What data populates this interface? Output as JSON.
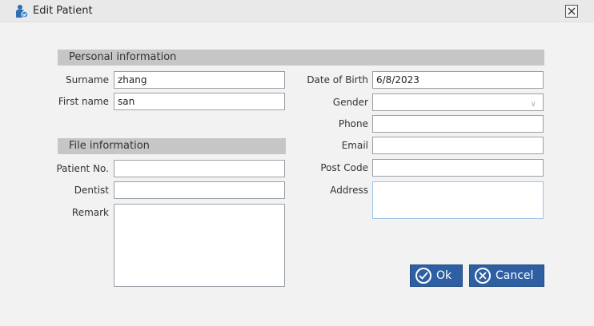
{
  "window": {
    "title": "Edit Patient"
  },
  "personal": {
    "header": "Personal information",
    "surname_label": "Surname",
    "surname_value": "zhang",
    "firstname_label": "First name",
    "firstname_value": "san",
    "dob_label": "Date of Birth",
    "dob_value": "6/8/2023",
    "gender_label": "Gender",
    "gender_value": "",
    "phone_label": "Phone",
    "phone_value": "",
    "email_label": "Email",
    "email_value": "",
    "postcode_label": "Post Code",
    "postcode_value": "",
    "address_label": "Address",
    "address_value": ""
  },
  "file": {
    "header": "File information",
    "patientno_label": "Patient No.",
    "patientno_value": "",
    "dentist_label": "Dentist",
    "dentist_value": "",
    "remark_label": "Remark",
    "remark_value": ""
  },
  "buttons": {
    "ok": "Ok",
    "cancel": "Cancel"
  },
  "icons": {
    "app": "patient-user-icon",
    "close": "close-icon",
    "ok": "check-circle-icon",
    "cancel": "x-circle-icon",
    "dropdown": "chevron-down-icon"
  },
  "colors": {
    "accent": "#2f5fa3",
    "section_bg": "#c6c6c6",
    "window_bg": "#f2f2f2"
  }
}
